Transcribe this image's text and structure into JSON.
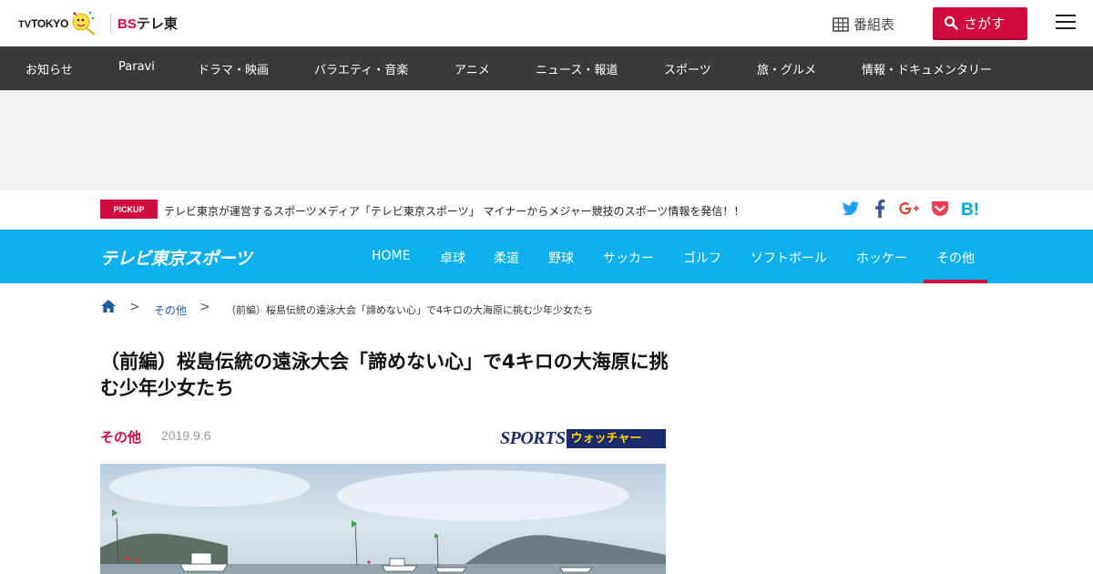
{
  "header": {
    "tvtokyo_tv": "TV",
    "tvtokyo_tokyo": "TOKYO",
    "bs_logo_bs": "BS",
    "bs_logo_rest": "テレ東",
    "bangumi_label": "番組表",
    "search_label": "さがす"
  },
  "genre_nav": [
    "お知らせ",
    "Paravi",
    "ドラマ・映画",
    "バラエティ・音楽",
    "アニメ",
    "ニュース・報道",
    "スポーツ",
    "旅・グルメ",
    "情報・ドキュメンタリー"
  ],
  "pickup": {
    "badge": "PICKUP",
    "text": "テレビ東京が運営するスポーツメディア「テレビ東京スポーツ」 マイナーからメジャー競技のスポーツ情報を発信！！"
  },
  "social_icons": [
    "twitter-icon",
    "facebook-icon",
    "google-plus-icon",
    "pocket-icon",
    "hatena-bookmark-icon"
  ],
  "sports_nav": {
    "logo": "テレビ東京スポーツ",
    "items": [
      "HOME",
      "卓球",
      "柔道",
      "野球",
      "サッカー",
      "ゴルフ",
      "ソフトボール",
      "ホッケー",
      "その他"
    ],
    "active": "その他"
  },
  "breadcrumb": {
    "sep": ">",
    "category": "その他",
    "current": "（前編）桜島伝統の遠泳大会「諦めない心」で4キロの大海原に挑む少年少女たち"
  },
  "article": {
    "title": "（前編）桜島伝統の遠泳大会「諦めない心」で4キロの大海原に挑む少年少女たち",
    "category": "その他",
    "date": "2019.9.6",
    "program_logo_sports": "SPORTS",
    "program_logo_watcher": "ウォッチャー"
  },
  "colors": {
    "accent_red": "#d10b3e",
    "sports_blue": "#0bb0ed",
    "genre_nav_bg": "#3a3a3a"
  }
}
